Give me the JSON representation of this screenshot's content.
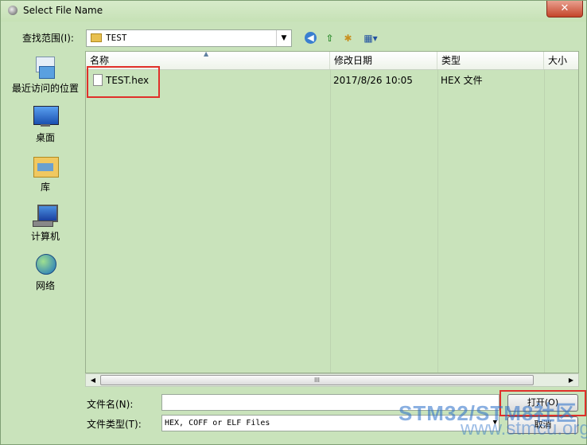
{
  "window": {
    "title": "Select File Name",
    "close_label": "✕"
  },
  "lookin": {
    "label": "查找范围(I):",
    "value": "TEST"
  },
  "toolbar": {
    "back": "◀",
    "up": "⇧",
    "new_folder": "✱",
    "view": "▦▾"
  },
  "places": [
    {
      "label": "最近访问的位置"
    },
    {
      "label": "桌面"
    },
    {
      "label": "库"
    },
    {
      "label": "计算机"
    },
    {
      "label": "网络"
    }
  ],
  "columns": {
    "name": "名称",
    "modified": "修改日期",
    "type": "类型",
    "size": "大小"
  },
  "files": [
    {
      "name": "TEST.hex",
      "modified": "2017/8/26 10:05",
      "type": "HEX 文件"
    }
  ],
  "scroll": {
    "left": "◀",
    "right": "▶",
    "grip": "III"
  },
  "filename": {
    "label": "文件名(N):",
    "value": ""
  },
  "filetype": {
    "label": "文件类型(T):",
    "value": "HEX, COFF or ELF Files"
  },
  "buttons": {
    "open": "打开(O)",
    "cancel": "取消"
  },
  "watermark": {
    "line1": "STM32/STM8社区",
    "line2": "www.stmcu.org"
  }
}
